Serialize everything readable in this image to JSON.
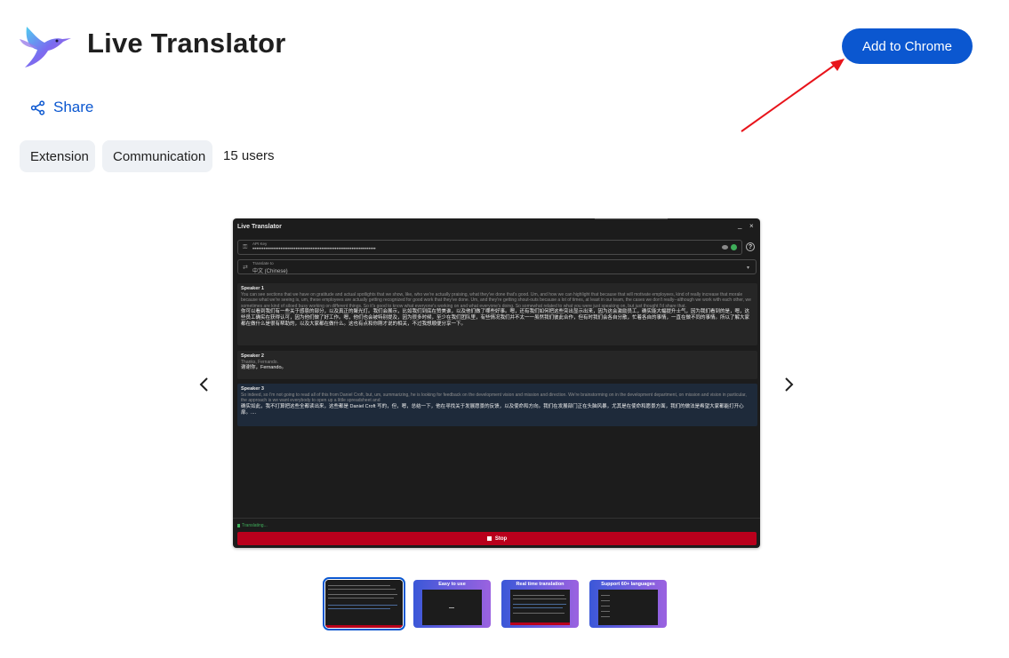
{
  "header": {
    "title": "Live Translator",
    "add_button": "Add to Chrome"
  },
  "share": {
    "label": "Share"
  },
  "chips": [
    {
      "label": "Extension"
    },
    {
      "label": "Communication"
    }
  ],
  "users_count": "15 users",
  "screenshot": {
    "app_title": "Live Translator",
    "window_controls": {
      "minimize": "_",
      "close": "×"
    },
    "api_key": {
      "label": "API Key",
      "value": "••••••••••••••••••••••••••••••••••••••••••••••••••••••••••••••••••"
    },
    "translate_to": {
      "label": "Translate to",
      "value": "中文 (Chinese)"
    },
    "help": "?",
    "messages": [
      {
        "speaker": "Speaker 1",
        "source": "You can see sections that we have on gratitude and actual spotlights that we show, like, who we're actually praising, what they've done that's good. Um, and how we can highlight that because that will motivate employees, kind of really increase that morale because what we're seeing is, um, these employees are actually getting recognized for good work that they've done. Um, and they're getting shout-outs because a lot of times, at least in our team, the cases we don't really--although we work with each other, we sometimes are kind of siloed busy working on different things. So it's good to know what everyone's working on and what everyone's doing. So somewhat related to what you were just speaking on, but just thought I'd share that.",
        "translation": "你可以看到我们有一些关于感恩的部分，以及真正的聚光灯。我们会展示，比如我们到底在赞美谁，以及他们做了哪些好事。嗯，还有我们如何把这些突出显示出来，因为这会激励员工，确实能大幅提升士气，因为我们看到的是，嗯，这些员工确实在获得认可，因为他们做了好工作。嗯，他们也会被特别提及，因为很多时候，至少在我们团队里，有些情况我们并不太一一虽然我们彼此合作，但有时我们会各自分散，忙着各自的事情，一直在做不同的事情。所以了解大家都在做什么是很有帮助的，以及大家都在做什么。这也有点和你刚才说的相关，不过我想顺便分享一下。"
      },
      {
        "speaker": "Speaker 2",
        "source": "Thanks, Fernando.",
        "translation": "谢谢你，Fernando。"
      },
      {
        "speaker": "Speaker 3",
        "source": "So indeed, so I'm not going to read all of this from Daniel Croft, but, um, summarizing, he is looking for feedback on the development vision and mission and direction. We're brainstorming on in the development department, on mission and vision in particular, the approach is we want everybody to open up a little spreadsheet and",
        "translation": "确实如此，我不打算把这些全都读出来，这些都是 Daniel Croft 写的，但，嗯，总结一下，他在寻找关于发展愿景的反馈，以及使命和方向。我们在发展部门正在头脑风暴，尤其是在使命和愿景方面，我们的做法是希望大家都能打开心扉。...."
      }
    ],
    "status": "Translating...",
    "stop_button": "Stop"
  },
  "thumbnails": [
    {
      "caption": ""
    },
    {
      "caption": "Easy to use"
    },
    {
      "caption": "Real time translation"
    },
    {
      "caption": "Support 60+ languages"
    }
  ],
  "colors": {
    "accent": "#0b57d0",
    "chip_bg": "#eef1f5",
    "annotation_arrow": "#e8141b",
    "stop_red": "#b9001c",
    "status_green": "#3fae5a"
  },
  "icons": {
    "logo": "hummingbird-logo",
    "share": "share-icon",
    "prev": "chevron-left-icon",
    "next": "chevron-right-icon"
  }
}
